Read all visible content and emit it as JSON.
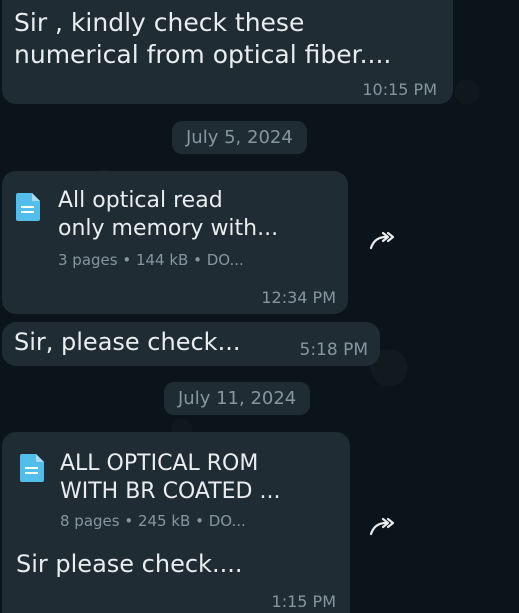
{
  "messages": {
    "m1": {
      "text_line1": "Sir , kindly check these",
      "text_line2": "numerical from optical fiber....",
      "time": "10:15 PM"
    },
    "date1": "July 5, 2024",
    "m2": {
      "doc_title_line1": "All optical read",
      "doc_title_line2": "only memory with...",
      "doc_meta": "3 pages • 144 kB • DO...",
      "time": "12:34 PM"
    },
    "m3": {
      "text": "Sir, please check...",
      "time": "5:18 PM"
    },
    "date2": "July 11, 2024",
    "m4": {
      "doc_title_line1": "ALL OPTICAL ROM",
      "doc_title_line2": "WITH BR COATED ...",
      "doc_meta": "8 pages • 245 kB • DO...",
      "caption": "Sir please check....",
      "time": "1:15 PM"
    }
  },
  "icons": {
    "document": "document-icon",
    "forward": "forward-icon"
  },
  "colors": {
    "background": "#0b141a",
    "bubble": "#1f2c34",
    "text": "#e9edef",
    "meta": "#8696a0",
    "doc_icon": "#53bdeb"
  }
}
